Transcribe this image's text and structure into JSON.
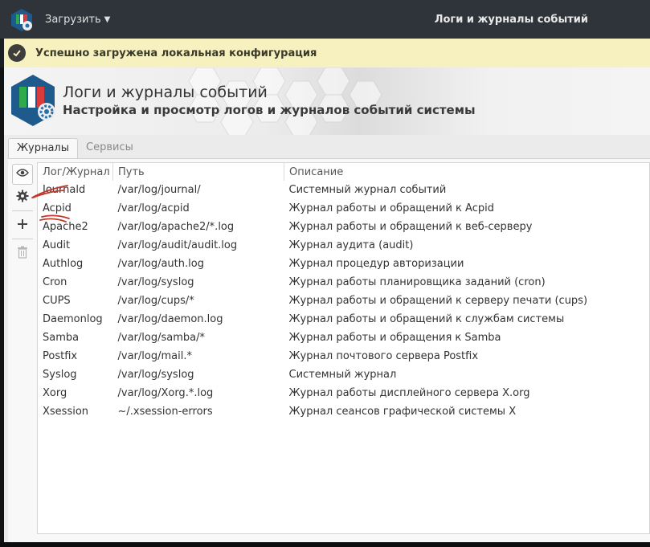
{
  "titlebar": {
    "menu_label": "Загрузить",
    "window_title": "Логи и журналы событий"
  },
  "notification": {
    "text": "Успешно загружена локальная конфигурация",
    "icon": "checkmark-icon"
  },
  "header": {
    "title": "Логи и журналы событий",
    "subtitle": "Настройка и просмотр логов и журналов событий системы"
  },
  "tabs": [
    {
      "label": "Журналы",
      "active": true
    },
    {
      "label": "Сервисы",
      "active": false
    }
  ],
  "toolbar": {
    "buttons": [
      {
        "icon": "eye-icon",
        "enabled": true
      },
      {
        "icon": "gear-icon",
        "enabled": true
      },
      {
        "icon": "plus-icon",
        "enabled": true
      },
      {
        "icon": "trash-icon",
        "enabled": false
      }
    ]
  },
  "table": {
    "columns": [
      "Лог/Журнал",
      "Путь",
      "Описание"
    ],
    "rows": [
      [
        "Journald",
        "/var/log/journal/",
        "Системный журнал событий"
      ],
      [
        "Acpid",
        "/var/log/acpid",
        "Журнал работы и обращений к Acpid"
      ],
      [
        "Apache2",
        "/var/log/apache2/*.log",
        "Журнал работы и обращений к веб-серверу"
      ],
      [
        "Audit",
        "/var/log/audit/audit.log",
        "Журнал аудита (audit)"
      ],
      [
        "Authlog",
        "/var/log/auth.log",
        "Журнал процедур авторизации"
      ],
      [
        "Cron",
        "/var/log/syslog",
        "Журнал работы планировщика заданий (cron)"
      ],
      [
        "CUPS",
        "/var/log/cups/*",
        "Журнал работы и обращений к серверу печати (cups)"
      ],
      [
        "Daemonlog",
        "/var/log/daemon.log",
        "Журнал работы и обращений к службам системы"
      ],
      [
        "Samba",
        "/var/log/samba/*",
        "Журнал работы и обращения к Samba"
      ],
      [
        "Postfix",
        "/var/log/mail.*",
        "Журнал почтового сервера Postfix"
      ],
      [
        "Syslog",
        "/var/log/syslog",
        "Системный журнал"
      ],
      [
        "Xorg",
        "/var/log/Xorg.*.log",
        "Журнал работы дисплейного сервера X.org"
      ],
      [
        "Xsession",
        "~/.xsession-errors",
        "Журнал сеансов графической системы X"
      ]
    ]
  },
  "colors": {
    "titlebar": "#2f343a",
    "notification": "#f6f1bf",
    "annotation_marks": "#c0392b"
  }
}
